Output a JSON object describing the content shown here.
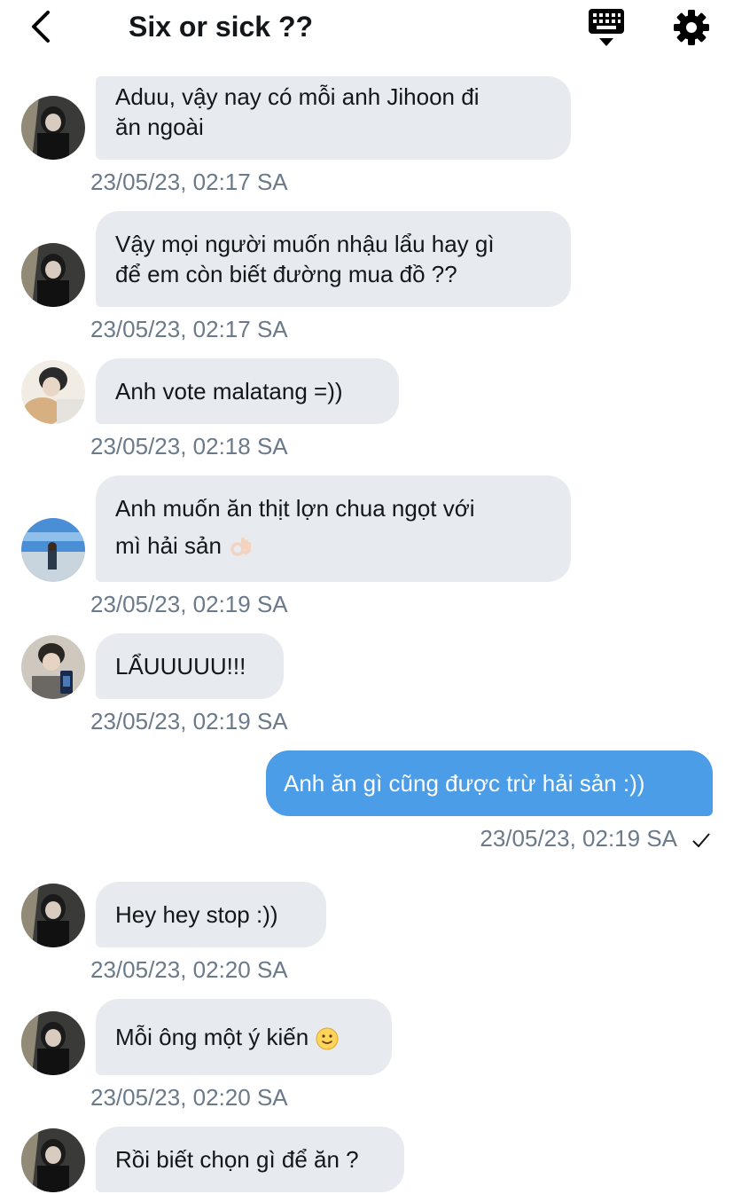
{
  "header": {
    "title": "Six or sick ??",
    "back_icon": "chevron-left-icon",
    "keyboard_icon": "keyboard-icon",
    "settings_icon": "gear-icon"
  },
  "messages": [
    {
      "text_line1": "Aduu, vậy nay có mỗi anh Jihoon đi",
      "text_line2": "ăn ngoài",
      "time": "23/05/23, 02:17 SA"
    },
    {
      "text_line1": "Vậy mọi người muốn nhậu lẩu hay gì",
      "text_line2": "để em còn biết đường mua đồ ??",
      "time": "23/05/23, 02:17 SA"
    },
    {
      "text": "Anh vote malatang =))",
      "time": "23/05/23, 02:18 SA"
    },
    {
      "text_line1": "Anh muốn ăn thịt lợn chua ngọt với",
      "text_line2": "mì hải sản",
      "emoji": "ok-hand-icon",
      "time": "23/05/23, 02:19 SA"
    },
    {
      "text": "LẨUUUUU!!!",
      "time": "23/05/23, 02:19 SA"
    },
    {
      "text": "Anh ăn gì cũng được trừ hải sản :))",
      "time": "23/05/23, 02:19 SA",
      "status_icon": "checkmark-icon",
      "sent": true
    },
    {
      "text": "Hey hey stop :))",
      "time": "23/05/23, 02:20 SA"
    },
    {
      "text": "Mỗi ông một ý kiến",
      "emoji": "slight-smile-icon",
      "time": "23/05/23, 02:20 SA"
    },
    {
      "text": "Rồi biết chọn gì để ăn ?"
    }
  ],
  "colors": {
    "sent_bubble": "#4a9de6",
    "received_bubble": "#e7ebef",
    "timestamp": "#6b7a8a"
  }
}
